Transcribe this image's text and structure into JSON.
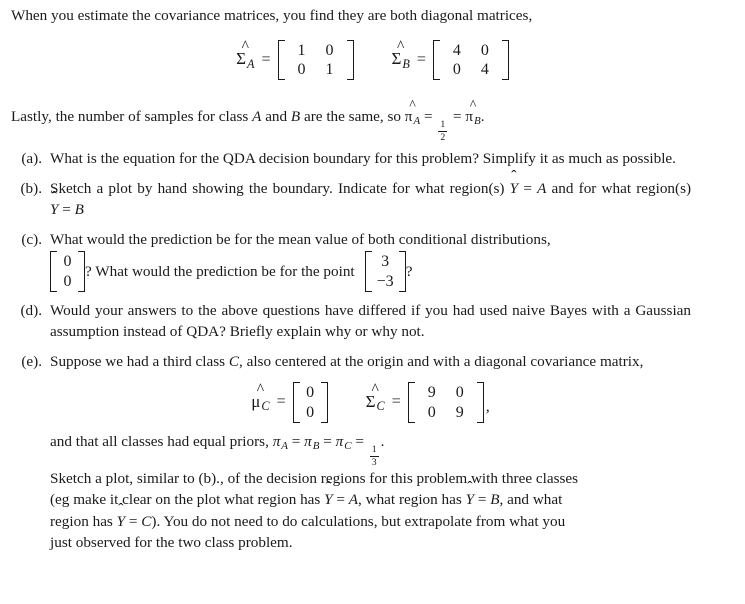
{
  "document": {
    "intro": "When you estimate the covariance matrices, you find they are both diagonal matrices,",
    "lastly_prefix": "Lastly, the number of samples for class ",
    "lastly_class_a": "A",
    "lastly_mid": " and ",
    "lastly_class_b": "B",
    "lastly_suffix": " are the same, so ",
    "lastly_end": "."
  },
  "equations": {
    "sigma_a": {
      "symbol": "Σ",
      "accent": "^",
      "subscript": "A",
      "equals": "=",
      "rows": [
        [
          "1",
          "0"
        ],
        [
          "0",
          "1"
        ]
      ]
    },
    "sigma_b": {
      "symbol": "Σ",
      "accent": "^",
      "subscript": "B",
      "equals": "=",
      "rows": [
        [
          "4",
          "0"
        ],
        [
          "0",
          "4"
        ]
      ]
    },
    "mu_c": {
      "symbol": "μ",
      "accent": "^",
      "subscript": "C",
      "equals": "=",
      "rows": [
        [
          "0"
        ],
        [
          "0"
        ]
      ]
    },
    "sigma_c": {
      "symbol": "Σ",
      "accent": "^",
      "subscript": "C",
      "equals": "=",
      "rows": [
        [
          "9",
          "0"
        ],
        [
          "0",
          "9"
        ]
      ],
      "trailing": ","
    },
    "priors_two_class": {
      "pi_symbol": "π",
      "accent": "^",
      "sub_a": "A",
      "sub_b": "B",
      "equals": "=",
      "fraction_num": "1",
      "fraction_den": "2"
    },
    "priors_three_class": {
      "pi_symbol": "π",
      "sub_a": "A",
      "sub_b": "B",
      "sub_c": "C",
      "equals": "=",
      "fraction_num": "1",
      "fraction_den": "3"
    }
  },
  "questions": [
    {
      "label": "(a).",
      "text": "What is the equation for the QDA decision boundary for this problem? Simplify it as much as possible."
    },
    {
      "label": "(b).",
      "text_1": "Sketch a plot by hand showing the boundary. Indicate for what region(s) ",
      "yhat": "Y",
      "eq": "=",
      "class_a": "A",
      "text_2": " and for what region(s) ",
      "class_b": "B"
    },
    {
      "label": "(c).",
      "text_1": "What would the prediction be for the mean value of both conditional distributions,",
      "vector_mean": [
        [
          "0"
        ],
        [
          "0"
        ]
      ],
      "text_2": "? What would the prediction be for the point",
      "vector_point": [
        [
          "3"
        ],
        [
          "−3"
        ]
      ],
      "text_3": "?"
    },
    {
      "label": "(d).",
      "text": "Would your answers to the above questions have differed if you had used naive Bayes with a Gaussian assumption instead of QDA? Briefly explain why or why not."
    },
    {
      "label": "(e).",
      "text_1": "Suppose we had a third class ",
      "class_c": "C",
      "text_2": ", also centered at the origin and with a diagonal covariance matrix,",
      "tail_line_1_prefix": "and that all classes had equal priors, ",
      "tail_line_1_suffix": ".",
      "tail_line_2": "Sketch a plot, similar to (b)., of the decision regions for this problem with three classes",
      "tail_line_3_a": "(eg make it clear on the plot what region has ",
      "tail_line_3_b": " = ",
      "tail_line_3_class_a": "A",
      "tail_line_3_c": ", what region has ",
      "tail_line_3_class_b": "B",
      "tail_line_3_d": ", and what",
      "tail_line_4_a": "region has ",
      "tail_line_4_class_c": "C",
      "tail_line_4_b": "). You do not need to do calculations, but extrapolate from what you",
      "tail_line_5": "just observed for the two class problem.",
      "yhat_symbol": "Y"
    }
  ],
  "style": {
    "text_color": "#1a1a1a",
    "background": "#ffffff"
  }
}
